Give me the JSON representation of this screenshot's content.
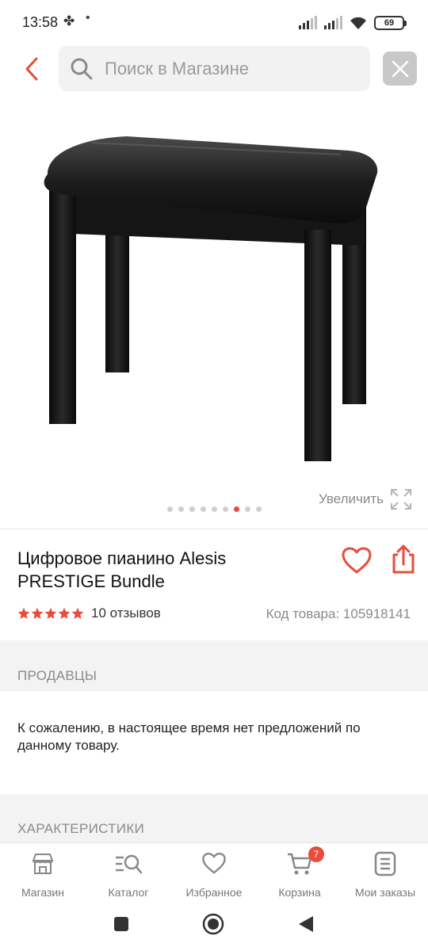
{
  "status": {
    "time": "13:58",
    "battery": "69"
  },
  "header": {
    "search_placeholder": "Поиск в Магазине"
  },
  "gallery": {
    "zoom_label": "Увеличить",
    "dots_total": 9,
    "active_dot": 7
  },
  "product": {
    "title": "Цифровое пианино Alesis PRESTIGE Bundle",
    "rating": 5,
    "reviews": "10 отзывов",
    "sku": "Код товара: 105918141"
  },
  "sellers": {
    "title": "ПРОДАВЦЫ",
    "message": "К сожалению, в настоящее время нет предложений по данному товару."
  },
  "specs": {
    "title": "ХАРАКТЕРИСТИКИ"
  },
  "bottom_nav": {
    "items": [
      {
        "label": "Магазин",
        "icon": "store-icon"
      },
      {
        "label": "Каталог",
        "icon": "catalog-icon"
      },
      {
        "label": "Избранное",
        "icon": "heart-icon"
      },
      {
        "label": "Корзина",
        "icon": "cart-icon"
      },
      {
        "label": "Мои заказы",
        "icon": "orders-icon"
      }
    ],
    "cart_badge": "7"
  },
  "colors": {
    "accent": "#e74c3c",
    "muted_text": "#8a8a8a",
    "section_bg": "#f3f3f3"
  }
}
